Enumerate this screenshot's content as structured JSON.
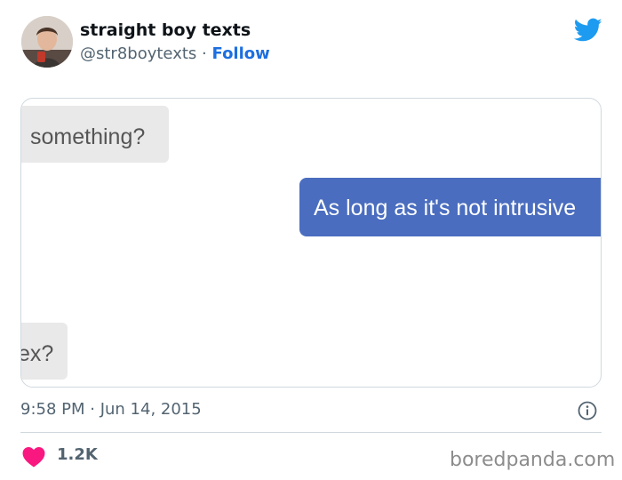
{
  "tweet": {
    "display_name": "straight boy texts",
    "handle": "@str8boytexts",
    "separator": "·",
    "follow_label": "Follow",
    "timestamp": "9:58 PM · Jun 14, 2015",
    "likes": "1.2K",
    "icons": {
      "platform": "twitter-bird-icon",
      "info": "info-icon",
      "like": "heart-icon"
    },
    "colors": {
      "follow_link": "#1d6fe0",
      "twitter_blue": "#1d9bf0",
      "heart": "#f91880",
      "secondary_text": "#536471"
    }
  },
  "media": {
    "messages": [
      {
        "side": "left",
        "text": "something?"
      },
      {
        "side": "right",
        "text": "As long as it's not intrusive"
      },
      {
        "side": "left",
        "text": "ex?"
      }
    ],
    "colors": {
      "received_bubble": "#e9e9e9",
      "sent_bubble": "#4a6dbf"
    }
  },
  "watermark": "boredpanda.com"
}
